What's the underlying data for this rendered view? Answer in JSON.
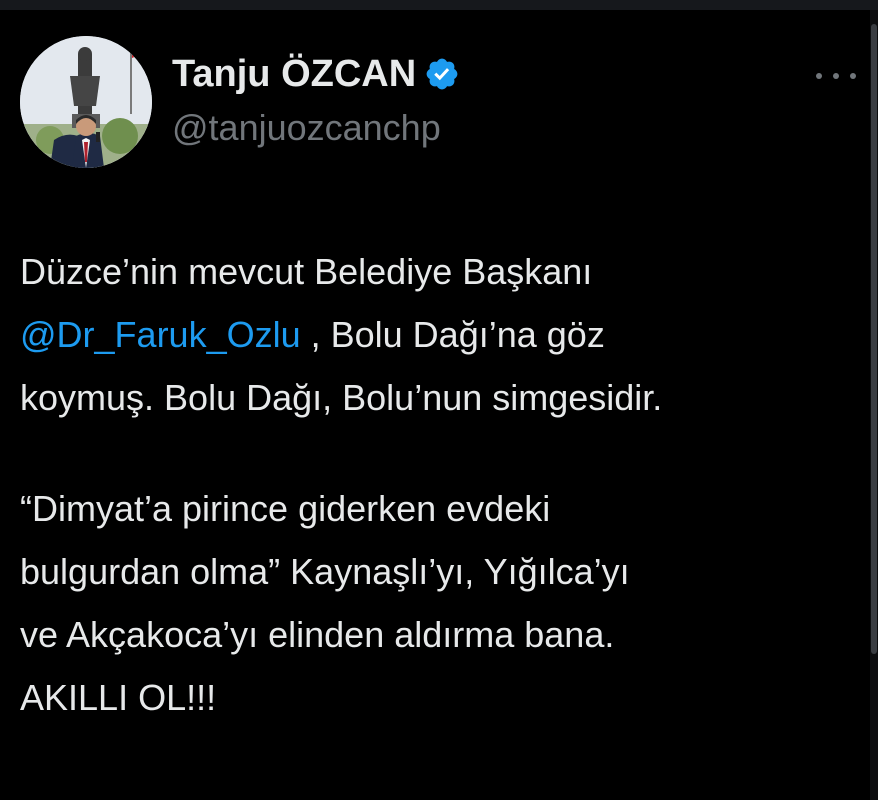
{
  "author": {
    "display_name": "Tanju ÖZCAN",
    "handle": "@tanjuozcanchp",
    "verified_icon": "verified-badge-icon",
    "verified_color": "#1d9bf0"
  },
  "tweet": {
    "para1": {
      "line1": "Düzce’nin mevcut Belediye Başkanı",
      "line2_mention": "@Dr_Faruk_Ozlu",
      "line2_rest": " , Bolu Dağı’na göz",
      "line3": "koymuş. Bolu Dağı, Bolu’nun simgesidir."
    },
    "para2": {
      "line1": "“Dimyat’a pirince giderken evdeki",
      "line2": "bulgurdan olma” Kaynaşlı’yı, Yığılca’yı",
      "line3": "ve Akçakoca’yı elinden aldırma bana.",
      "line4": "AKILLI OL!!!"
    }
  },
  "colors": {
    "background": "#000000",
    "text": "#e7e9ea",
    "muted": "#71767b",
    "link": "#1d9bf0"
  }
}
